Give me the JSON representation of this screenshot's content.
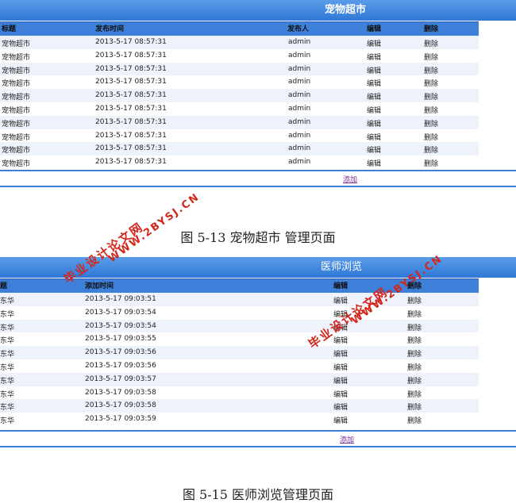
{
  "panel1": {
    "title": "宠物超市",
    "columns": [
      "标题",
      "发布时间",
      "发布人",
      "编辑",
      "删除"
    ],
    "rows": [
      {
        "title": "宠物超市",
        "time": "2013-5-17 08:57:31",
        "author": "admin",
        "edit": "编辑",
        "del": "删除"
      },
      {
        "title": "宠物超市",
        "time": "2013-5-17 08:57:31",
        "author": "admin",
        "edit": "编辑",
        "del": "删除"
      },
      {
        "title": "宠物超市",
        "time": "2013-5-17 08:57:31",
        "author": "admin",
        "edit": "编辑",
        "del": "删除"
      },
      {
        "title": "宠物超市",
        "time": "2013-5-17 08:57:31",
        "author": "admin",
        "edit": "编辑",
        "del": "删除"
      },
      {
        "title": "宠物超市",
        "time": "2013-5-17 08:57:31",
        "author": "admin",
        "edit": "编辑",
        "del": "删除"
      },
      {
        "title": "宠物超市",
        "time": "2013-5-17 08:57:31",
        "author": "admin",
        "edit": "编辑",
        "del": "删除"
      },
      {
        "title": "宠物超市",
        "time": "2013-5-17 08:57:31",
        "author": "admin",
        "edit": "编辑",
        "del": "删除"
      },
      {
        "title": "宠物超市",
        "time": "2013-5-17 08:57:31",
        "author": "admin",
        "edit": "编辑",
        "del": "删除"
      },
      {
        "title": "宠物超市",
        "time": "2013-5-17 08:57:31",
        "author": "admin",
        "edit": "编辑",
        "del": "删除"
      },
      {
        "title": "宠物超市",
        "time": "2013-5-17 08:57:31",
        "author": "admin",
        "edit": "编辑",
        "del": "删除"
      }
    ],
    "add_label": "添加",
    "caption": "图 5-13 宠物超市  管理页面"
  },
  "panel2": {
    "title": "医师浏览",
    "columns": [
      "题",
      "添加时间",
      "编辑",
      "删除"
    ],
    "rows": [
      {
        "title": "东华",
        "time": "2013-5-17 09:03:51",
        "edit": "编辑",
        "del": "删除"
      },
      {
        "title": "东华",
        "time": "2013-5-17 09:03:54",
        "edit": "编辑",
        "del": "删除"
      },
      {
        "title": "东华",
        "time": "2013-5-17 09:03:54",
        "edit": "编辑",
        "del": "删除"
      },
      {
        "title": "东华",
        "time": "2013-5-17 09:03:55",
        "edit": "编辑",
        "del": "删除"
      },
      {
        "title": "东华",
        "time": "2013-5-17 09:03:56",
        "edit": "编辑",
        "del": "删除"
      },
      {
        "title": "东华",
        "time": "2013-5-17 09:03:56",
        "edit": "编辑",
        "del": "删除"
      },
      {
        "title": "东华",
        "time": "2013-5-17 09:03:57",
        "edit": "编辑",
        "del": "删除"
      },
      {
        "title": "东华",
        "time": "2013-5-17 09:03:58",
        "edit": "编辑",
        "del": "删除"
      },
      {
        "title": "东华",
        "time": "2013-5-17 09:03:58",
        "edit": "编辑",
        "del": "删除"
      },
      {
        "title": "东华",
        "time": "2013-5-17 09:03:59",
        "edit": "编辑",
        "del": "删除"
      }
    ],
    "add_label": "添加",
    "caption": "图 5-15 医师浏览管理页面"
  },
  "watermarks": [
    "毕业设计论文网",
    "WWW.2BYSJ.CN"
  ],
  "colors": {
    "header_blue": "#3d7fd9",
    "watermark_red": "#d4261a",
    "link_purple": "#7a2a9a"
  }
}
